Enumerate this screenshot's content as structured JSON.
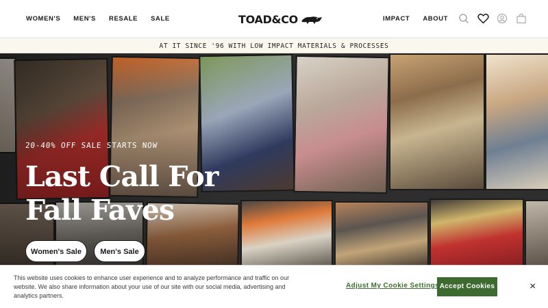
{
  "header": {
    "nav_left": [
      "WOMEN'S",
      "MEN'S",
      "RESALE",
      "SALE"
    ],
    "logo": "TOAD&CO",
    "nav_right": [
      "IMPACT",
      "ABOUT"
    ],
    "icons": [
      "search-icon",
      "heart-icon",
      "account-icon",
      "bag-icon"
    ]
  },
  "banner": {
    "text": "AT IT SINCE '96 WITH LOW IMPACT MATERIALS & PROCESSES"
  },
  "hero": {
    "tagline": "20-40% OFF SALE STARTS NOW",
    "headline": "Last Call For Fall Faves",
    "buttons": [
      "Women's Sale",
      "Men's Sale"
    ]
  },
  "cookie": {
    "text": "This website uses cookies to enhance user experience and to analyze performance and traffic on our website. We also share information about your use of our site with our social media, advertising and analytics partners.",
    "adjust_label": "Adjust My Cookie Settings",
    "accept_label": "Accept Cookies",
    "close_label": "×"
  },
  "colors": {
    "accent_green": "#3d6b2f",
    "banner_bg": "#faf7ee"
  }
}
